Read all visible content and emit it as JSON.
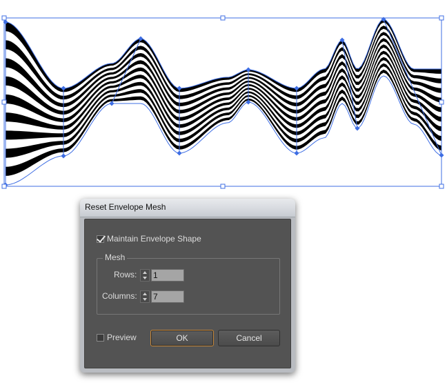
{
  "dialog": {
    "title": "Reset Envelope Mesh",
    "maintain_label": "Maintain Envelope Shape",
    "maintain_checked": true,
    "mesh_group_label": "Mesh",
    "rows_label": "Rows:",
    "rows_value": "1",
    "columns_label": "Columns:",
    "columns_value": "7",
    "preview_label": "Preview",
    "preview_checked": false,
    "ok_label": "OK",
    "cancel_label": "Cancel"
  },
  "artwork": {
    "stripe_color": "#000000",
    "selection_color": "#3d6de3",
    "stripe_count": 9
  }
}
